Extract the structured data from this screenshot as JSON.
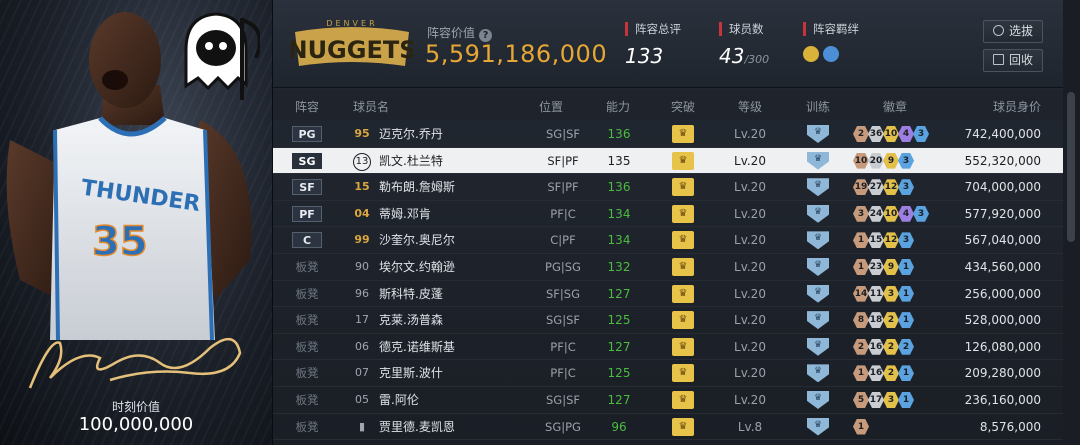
{
  "card": {
    "value_label": "时刻价值",
    "value": "100,000,000",
    "jersey_text": "THUNDER",
    "jersey_number": "35"
  },
  "header": {
    "lineup_value_label": "阵容价值",
    "lineup_value": "5,591,186,000",
    "team_logo_text": "NUGGETS",
    "team_logo_subtext": "DENVER",
    "stats": {
      "rating_label": "阵容总评",
      "rating_value": "133",
      "count_label": "球员数",
      "count_value": "43",
      "count_max": "/300",
      "bond_label": "阵容羁绊"
    },
    "buttons": {
      "select": "选拔",
      "recycle": "回收"
    }
  },
  "columns": {
    "slot": "阵容",
    "name": "球员名",
    "position": "位置",
    "ability": "能力",
    "breakthrough": "突破",
    "level": "等级",
    "training": "训练",
    "badges": "徽章",
    "price": "球员身价"
  },
  "rows": [
    {
      "slot": "PG",
      "starter": true,
      "num": "95",
      "num_style": "gold",
      "name": "迈克尔.乔丹",
      "pos": "SG|SF",
      "ability": "136",
      "level": "Lv.20",
      "badges": [
        [
          "2",
          "bronze"
        ],
        [
          "36",
          "silver"
        ],
        [
          "10",
          "gold"
        ],
        [
          "4",
          "purple"
        ],
        [
          "3",
          "blue"
        ]
      ],
      "price": "742,400,000"
    },
    {
      "slot": "SG",
      "starter": true,
      "num": "13",
      "num_style": "ring",
      "name": "凯文.杜兰特",
      "pos": "SF|PF",
      "ability": "135",
      "level": "Lv.20",
      "badges": [
        [
          "10",
          "bronze"
        ],
        [
          "20",
          "silver"
        ],
        [
          "9",
          "gold"
        ],
        [
          "3",
          "blue"
        ]
      ],
      "price": "552,320,000",
      "selected": true
    },
    {
      "slot": "SF",
      "starter": true,
      "num": "15",
      "num_style": "gold",
      "name": "勒布朗.詹姆斯",
      "pos": "SF|PF",
      "ability": "136",
      "level": "Lv.20",
      "badges": [
        [
          "19",
          "bronze"
        ],
        [
          "27",
          "silver"
        ],
        [
          "12",
          "gold"
        ],
        [
          "3",
          "blue"
        ]
      ],
      "price": "704,000,000"
    },
    {
      "slot": "PF",
      "starter": true,
      "num": "04",
      "num_style": "gold",
      "name": "蒂姆.邓肯",
      "pos": "PF|C",
      "ability": "134",
      "level": "Lv.20",
      "badges": [
        [
          "3",
          "bronze"
        ],
        [
          "24",
          "silver"
        ],
        [
          "10",
          "gold"
        ],
        [
          "4",
          "purple"
        ],
        [
          "3",
          "blue"
        ]
      ],
      "price": "577,920,000"
    },
    {
      "slot": "C",
      "starter": true,
      "num": "99",
      "num_style": "gold",
      "name": "沙奎尔.奥尼尔",
      "pos": "C|PF",
      "ability": "134",
      "level": "Lv.20",
      "badges": [
        [
          "1",
          "bronze"
        ],
        [
          "15",
          "silver"
        ],
        [
          "12",
          "gold"
        ],
        [
          "3",
          "blue"
        ]
      ],
      "price": "567,040,000"
    },
    {
      "slot": "板凳",
      "starter": false,
      "num": "90",
      "num_style": "plain",
      "name": "埃尔文.约翰逊",
      "pos": "PG|SG",
      "ability": "132",
      "level": "Lv.20",
      "badges": [
        [
          "1",
          "bronze"
        ],
        [
          "23",
          "silver"
        ],
        [
          "9",
          "gold"
        ],
        [
          "1",
          "blue"
        ]
      ],
      "price": "434,560,000"
    },
    {
      "slot": "板凳",
      "starter": false,
      "num": "96",
      "num_style": "plain",
      "name": "斯科特.皮蓬",
      "pos": "SF|SG",
      "ability": "127",
      "level": "Lv.20",
      "badges": [
        [
          "14",
          "bronze"
        ],
        [
          "11",
          "silver"
        ],
        [
          "3",
          "gold"
        ],
        [
          "1",
          "blue"
        ]
      ],
      "price": "256,000,000"
    },
    {
      "slot": "板凳",
      "starter": false,
      "num": "17",
      "num_style": "plain",
      "name": "克莱.汤普森",
      "pos": "SG|SF",
      "ability": "125",
      "level": "Lv.20",
      "badges": [
        [
          "8",
          "bronze"
        ],
        [
          "18",
          "silver"
        ],
        [
          "2",
          "gold"
        ],
        [
          "1",
          "blue"
        ]
      ],
      "price": "528,000,000"
    },
    {
      "slot": "板凳",
      "starter": false,
      "num": "06",
      "num_style": "plain",
      "name": "德克.诺维斯基",
      "pos": "PF|C",
      "ability": "127",
      "level": "Lv.20",
      "badges": [
        [
          "2",
          "bronze"
        ],
        [
          "16",
          "silver"
        ],
        [
          "2",
          "gold"
        ],
        [
          "2",
          "blue"
        ]
      ],
      "price": "126,080,000"
    },
    {
      "slot": "板凳",
      "starter": false,
      "num": "07",
      "num_style": "plain",
      "name": "克里斯.波什",
      "pos": "PF|C",
      "ability": "125",
      "level": "Lv.20",
      "badges": [
        [
          "1",
          "bronze"
        ],
        [
          "16",
          "silver"
        ],
        [
          "2",
          "gold"
        ],
        [
          "1",
          "blue"
        ]
      ],
      "price": "209,280,000"
    },
    {
      "slot": "板凳",
      "starter": false,
      "num": "05",
      "num_style": "plain",
      "name": "雷.阿伦",
      "pos": "SG|SF",
      "ability": "127",
      "level": "Lv.20",
      "badges": [
        [
          "5",
          "bronze"
        ],
        [
          "17",
          "silver"
        ],
        [
          "3",
          "gold"
        ],
        [
          "1",
          "blue"
        ]
      ],
      "price": "236,160,000"
    },
    {
      "slot": "板凳",
      "starter": false,
      "num": "",
      "num_style": "bars",
      "name": "贾里德.麦凯恩",
      "pos": "SG|PG",
      "ability": "96",
      "level": "Lv.8",
      "badges": [
        [
          "1",
          "bronze"
        ]
      ],
      "price": "8,576,000"
    }
  ]
}
